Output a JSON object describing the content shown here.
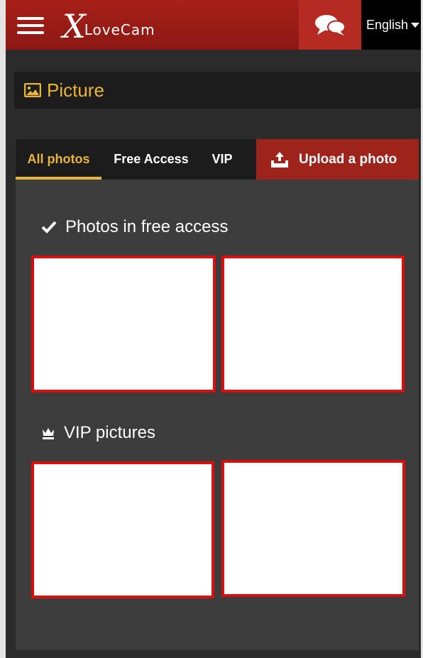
{
  "header": {
    "logo_initial": "X",
    "logo_text": "LoveCam",
    "language": "English"
  },
  "picture_section": {
    "title": "Picture"
  },
  "tabs": [
    {
      "label": "All photos",
      "active": true
    },
    {
      "label": "Free Access",
      "active": false
    },
    {
      "label": "VIP",
      "active": false
    }
  ],
  "upload": {
    "label": "Upload a photo"
  },
  "free_access": {
    "title": "Photos in free access"
  },
  "vip": {
    "title": "VIP pictures"
  },
  "colors": {
    "brand_red": "#a8201a",
    "accent_gold": "#e9b43c",
    "photo_border": "#d80f0f"
  }
}
